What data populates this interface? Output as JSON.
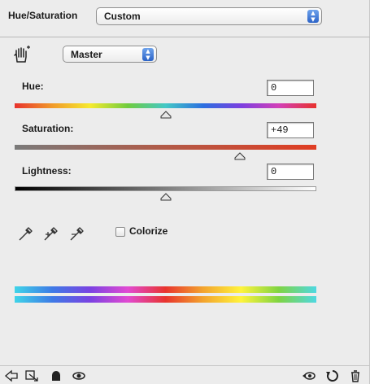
{
  "panel": {
    "title": "Hue/Saturation",
    "preset": "Custom",
    "channel": "Master"
  },
  "adjustments": {
    "hue": {
      "label": "Hue:",
      "value": "0",
      "level": 0.5
    },
    "saturation": {
      "label": "Saturation:",
      "value": "+49",
      "level": 0.745
    },
    "lightness": {
      "label": "Lightness:",
      "value": "0",
      "level": 0.5
    }
  },
  "colorize": {
    "label": "Colorize",
    "checked": false
  },
  "icons": {
    "hand": "on-image-adjust-hand-icon",
    "eyedroppers": [
      "eyedropper-icon",
      "eyedropper-plus-icon",
      "eyedropper-minus-icon"
    ],
    "footer_left": [
      "back-arrow-icon",
      "clip-to-layer-icon",
      "mask-icon",
      "visibility-eye-icon"
    ],
    "footer_right": [
      "view-previous-icon",
      "reset-icon",
      "trash-icon"
    ]
  },
  "colors": {
    "accent": "#2b63c7",
    "saturation_end": "#e03d23"
  }
}
